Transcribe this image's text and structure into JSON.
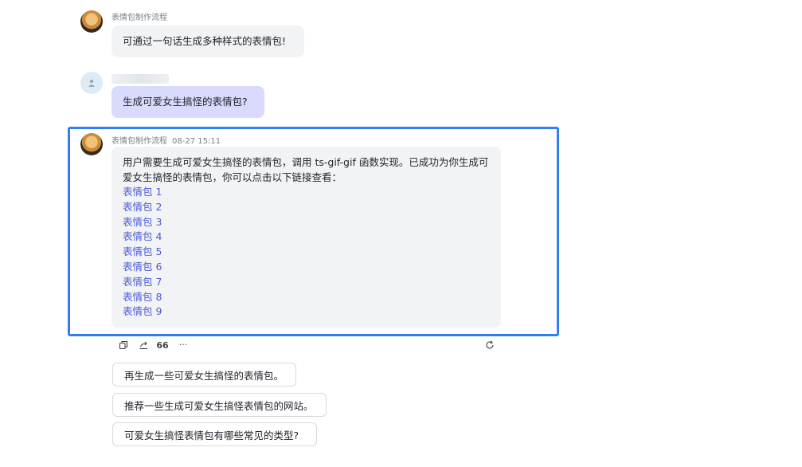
{
  "messages": [
    {
      "sender": "表情包制作流程",
      "text": "可通过一句话生成多种样式的表情包!"
    },
    {
      "sender_blurred": true,
      "text": "生成可爱女生搞怪的表情包?"
    },
    {
      "sender": "表情包制作流程",
      "time": "08-27 15:11",
      "text": "用户需要生成可爱女生搞怪的表情包，调用 ts-gif-gif 函数实现。已成功为你生成可爱女生搞怪的表情包，你可以点击以下链接查看：",
      "links": [
        "表情包 1",
        "表情包 2",
        "表情包 3",
        "表情包 4",
        "表情包 5",
        "表情包 6",
        "表情包 7",
        "表情包 8",
        "表情包 9"
      ]
    }
  ],
  "toolbar": {
    "copy_icon": "copy-icon",
    "share_icon": "share-icon",
    "quote_label": "66",
    "more_label": "···",
    "regenerate_icon": "refresh-icon"
  },
  "suggestions": [
    "再生成一些可爱女生搞怪的表情包。",
    "推荐一些生成可爱女生搞怪表情包的网站。",
    "可爱女生搞怪表情包有哪些常见的类型?"
  ],
  "colors": {
    "accent": "#2f7ef5",
    "link": "#4a5bd8",
    "user_bubble": "#d9dafc",
    "bot_bubble": "#f2f3f5"
  }
}
